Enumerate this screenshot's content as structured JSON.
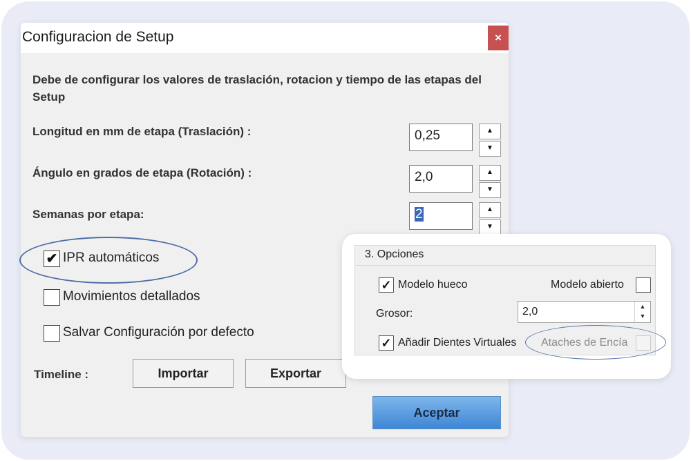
{
  "dialog": {
    "title": "Configuracion de Setup",
    "close_label": "×",
    "description": "Debe de configurar los valores de traslación,  rotacion y tiempo de las etapas del Setup",
    "fields": [
      {
        "label": "Longitud en mm de etapa (Traslación) :",
        "value": "0,25"
      },
      {
        "label": "Ángulo en grados de etapa (Rotación) :",
        "value": "2,0"
      },
      {
        "label": "Semanas por etapa:",
        "value": "2"
      }
    ],
    "spinner_up": "▲",
    "spinner_down": "▼",
    "checkboxes": [
      {
        "label": "IPR automáticos",
        "checked": true
      },
      {
        "label": "Movimientos detallados",
        "checked": false
      },
      {
        "label": "Salvar Configuración por defecto",
        "checked": false
      }
    ],
    "check_mark": "✔",
    "timeline_label": "Timeline :",
    "import_button": "Importar",
    "export_button": "Exportar",
    "accept_button": "Aceptar"
  },
  "options_panel": {
    "title": "3. Opciones",
    "modelo_hueco": {
      "label": "Modelo hueco",
      "checked": true
    },
    "modelo_abierto": {
      "label": "Modelo abierto",
      "checked": false
    },
    "grosor_label": "Grosor:",
    "grosor_value": "2,0",
    "grosor_spin": "▲▼",
    "dientes_virtuales": {
      "label": "Añadir Dientes Virtuales",
      "checked": true
    },
    "ataches_encia": {
      "label": "Ataches de Encía",
      "checked": false,
      "disabled": true
    },
    "check_mark": "✓"
  },
  "colors": {
    "close_button": "#c75050",
    "accent_blue": "#3e86d6",
    "highlight_ellipse": "#4e6ea8"
  }
}
